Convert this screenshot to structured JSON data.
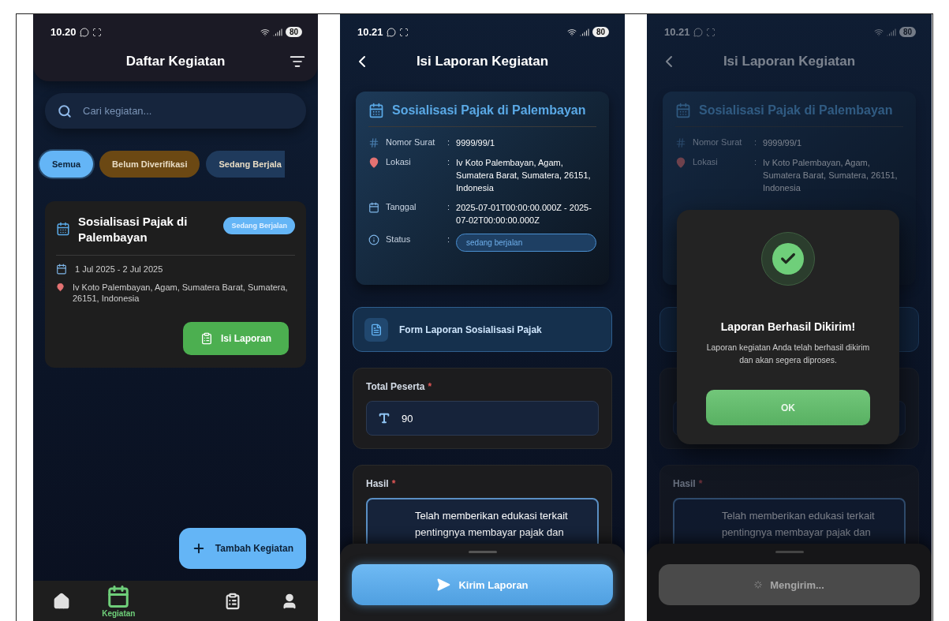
{
  "phones": [
    {
      "kind": "list",
      "status_bar": {
        "time": "10.20",
        "battery": "80"
      },
      "header": {
        "title": "Daftar Kegiatan"
      },
      "search": {
        "placeholder": "Cari kegiatan..."
      },
      "filters": [
        {
          "label": "Semua",
          "selected": true,
          "color": "#64b5f6"
        },
        {
          "label": "Belum Diverifikasi",
          "selected": false,
          "color": "#6b4813"
        },
        {
          "label": "Sedang Berjala",
          "selected": false,
          "color": "#1f3a5c"
        }
      ],
      "activities": [
        {
          "title": "Sosialisasi Pajak di Palembayan",
          "badge": "Sedang Berjalan",
          "date": "1 Jul 2025 - 2 Jul 2025",
          "location": "Iv Koto Palembayan, Agam, Sumatera Barat, Sumatera, 26151, Indonesia",
          "action": "Isi Laporan"
        }
      ],
      "fab": "Tambah Kegiatan",
      "nav": [
        {
          "kind": "home",
          "selected": false
        },
        {
          "kind": "calendar",
          "selected": true,
          "label": "Kegiatan"
        },
        {
          "kind": "clipboard",
          "selected": false
        },
        {
          "kind": "person",
          "selected": false
        }
      ]
    },
    {
      "kind": "form",
      "dimmed": false,
      "status_bar": {
        "time": "10.21",
        "battery": "80"
      },
      "header": {
        "title": "Isi Laporan Kegiatan"
      },
      "info_card": {
        "title": "Sosialisasi Pajak di Palembayan",
        "rows": [
          {
            "kind": "number",
            "label": "Nomor Surat",
            "colon": ":",
            "value": "9999/99/1"
          },
          {
            "kind": "location",
            "label": "Lokasi",
            "colon": ":",
            "value": "Iv Koto Palembayan, Agam, Sumatera Barat, Sumatera, 26151, Indonesia"
          },
          {
            "kind": "date",
            "label": "Tanggal",
            "colon": ":",
            "value": "2025-07-01T00:00:00.000Z - 2025-07-02T00:00:00.000Z"
          },
          {
            "kind": "status",
            "label": "Status",
            "colon": ":",
            "value": "sedang berjalan"
          }
        ]
      },
      "form_title": "Form Laporan Sosialisasi Pajak",
      "fields": [
        {
          "kind": "text",
          "label": "Total Peserta",
          "required": "*",
          "value": "90"
        },
        {
          "kind": "textarea",
          "label": "Hasil",
          "required": "*",
          "value": "Telah memberikan edukasi terkait pentingnya membayar pajak dan"
        }
      ],
      "submit": {
        "label": "Kirim Laporan",
        "disabled": false
      }
    },
    {
      "kind": "form",
      "dimmed": true,
      "status_bar": {
        "time": "10.21",
        "battery": "80"
      },
      "header": {
        "title": "Isi Laporan Kegiatan"
      },
      "info_card": {
        "title": "Sosialisasi Pajak di Palembayan",
        "rows": [
          {
            "kind": "number",
            "label": "Nomor Surat",
            "colon": ":",
            "value": "9999/99/1"
          },
          {
            "kind": "location",
            "label": "Lokasi",
            "colon": ":",
            "value": "Iv Koto Palembayan, Agam, Sumatera Barat, Sumatera, 26151, Indonesia"
          }
        ]
      },
      "fields": [
        {
          "kind": "text"
        },
        {
          "kind": "textarea",
          "label": "Hasil",
          "required": "*",
          "value": "Telah memberikan edukasi terkait pentingnya membayar pajak dan"
        }
      ],
      "submit": {
        "label": "Mengirim...",
        "disabled": true
      },
      "dialog": {
        "title": "Laporan Berhasil Dikirim!",
        "message": "Laporan kegiatan Anda telah berhasil dikirim dan akan segera diproses.",
        "button": "OK"
      }
    }
  ]
}
